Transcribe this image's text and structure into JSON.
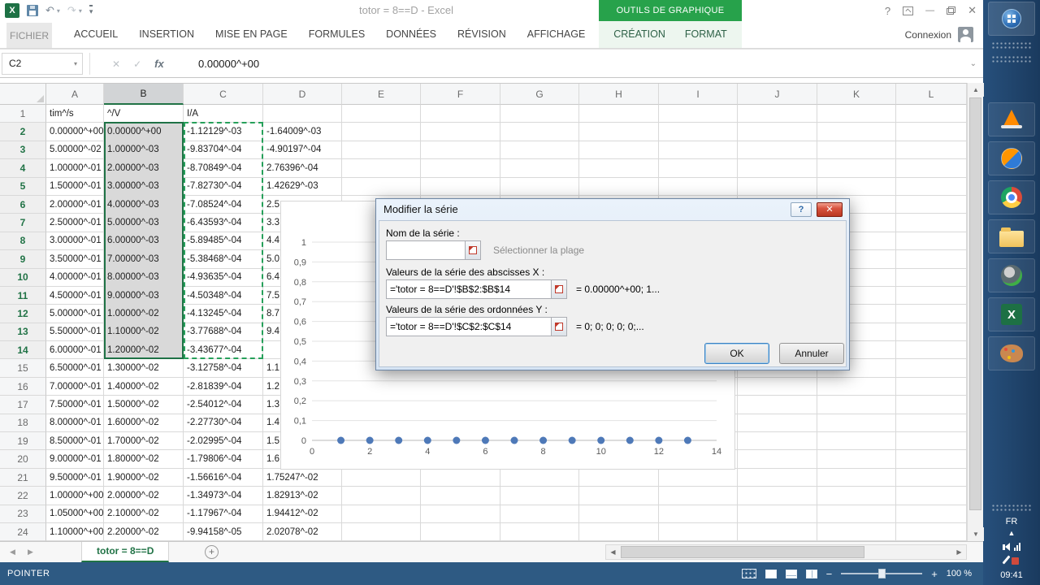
{
  "title_bar": {
    "title": "totor = 8==D - Excel",
    "contextual_header": "OUTILS DE GRAPHIQUE",
    "controls": {
      "help": "?",
      "minimize": "—",
      "close": "✕"
    }
  },
  "qat": {
    "app_glyph": "X",
    "undo": "↶",
    "redo": "↷",
    "dropdown": "▾",
    "more": "▾"
  },
  "ribbon": {
    "file_tab": "FICHIER",
    "tabs": [
      "ACCUEIL",
      "INSERTION",
      "MISE EN PAGE",
      "FORMULES",
      "DONNÉES",
      "RÉVISION",
      "AFFICHAGE"
    ],
    "contextual_tabs": [
      "CRÉATION",
      "FORMAT"
    ],
    "account": "Connexion"
  },
  "formula_bar": {
    "name_box": "C2",
    "namebox_arrow": "▾",
    "cancel_glyph": "✕",
    "enter_glyph": "✓",
    "fx_glyph": "fx",
    "formula": "0.00000^+00",
    "expand": "⌄"
  },
  "grid": {
    "columns": [
      "A",
      "B",
      "C",
      "D",
      "E",
      "F",
      "G",
      "H",
      "I",
      "J",
      "K",
      "L"
    ],
    "selection": {
      "solid_range_col": "B",
      "dashed_range_col": "C",
      "from_row": 2,
      "to_row": 14
    },
    "rows": [
      {
        "n": 1,
        "cells": [
          "tim^/s",
          "^/V",
          "I/A",
          ""
        ]
      },
      {
        "n": 2,
        "cells": [
          "0.00000^+00",
          "0.00000^+00",
          "-1.12129^-03",
          "-1.64009^-03"
        ]
      },
      {
        "n": 3,
        "cells": [
          "5.00000^-02",
          "1.00000^-03",
          "-9.83704^-04",
          "-4.90197^-04"
        ]
      },
      {
        "n": 4,
        "cells": [
          "1.00000^-01",
          "2.00000^-03",
          "-8.70849^-04",
          "2.76396^-04"
        ]
      },
      {
        "n": 5,
        "cells": [
          "1.50000^-01",
          "3.00000^-03",
          "-7.82730^-04",
          "1.42629^-03"
        ]
      },
      {
        "n": 6,
        "cells": [
          "2.00000^-01",
          "4.00000^-03",
          "-7.08524^-04",
          "2.5"
        ]
      },
      {
        "n": 7,
        "cells": [
          "2.50000^-01",
          "5.00000^-03",
          "-6.43593^-04",
          "3.3"
        ]
      },
      {
        "n": 8,
        "cells": [
          "3.00000^-01",
          "6.00000^-03",
          "-5.89485^-04",
          "4.4"
        ]
      },
      {
        "n": 9,
        "cells": [
          "3.50000^-01",
          "7.00000^-03",
          "-5.38468^-04",
          "5.0"
        ]
      },
      {
        "n": 10,
        "cells": [
          "4.00000^-01",
          "8.00000^-03",
          "-4.93635^-04",
          "6.4"
        ]
      },
      {
        "n": 11,
        "cells": [
          "4.50000^-01",
          "9.00000^-03",
          "-4.50348^-04",
          "7.5"
        ]
      },
      {
        "n": 12,
        "cells": [
          "5.00000^-01",
          "1.00000^-02",
          "-4.13245^-04",
          "8.7"
        ]
      },
      {
        "n": 13,
        "cells": [
          "5.50000^-01",
          "1.10000^-02",
          "-3.77688^-04",
          "9.4"
        ]
      },
      {
        "n": 14,
        "cells": [
          "6.00000^-01",
          "1.20000^-02",
          "-3.43677^-04",
          ""
        ]
      },
      {
        "n": 15,
        "cells": [
          "6.50000^-01",
          "1.30000^-02",
          "-3.12758^-04",
          "1.1"
        ]
      },
      {
        "n": 16,
        "cells": [
          "7.00000^-01",
          "1.40000^-02",
          "-2.81839^-04",
          "1.2"
        ]
      },
      {
        "n": 17,
        "cells": [
          "7.50000^-01",
          "1.50000^-02",
          "-2.54012^-04",
          "1.3"
        ]
      },
      {
        "n": 18,
        "cells": [
          "8.00000^-01",
          "1.60000^-02",
          "-2.27730^-04",
          "1.4"
        ]
      },
      {
        "n": 19,
        "cells": [
          "8.50000^-01",
          "1.70000^-02",
          "-2.02995^-04",
          "1.5"
        ]
      },
      {
        "n": 20,
        "cells": [
          "9.00000^-01",
          "1.80000^-02",
          "-1.79806^-04",
          "1.6"
        ]
      },
      {
        "n": 21,
        "cells": [
          "9.50000^-01",
          "1.90000^-02",
          "-1.56616^-04",
          "1.75247^-02"
        ]
      },
      {
        "n": 22,
        "cells": [
          "1.00000^+00",
          "2.00000^-02",
          "-1.34973^-04",
          "1.82913^-02"
        ]
      },
      {
        "n": 23,
        "cells": [
          "1.05000^+00",
          "2.10000^-02",
          "-1.17967^-04",
          "1.94412^-02"
        ]
      },
      {
        "n": 24,
        "cells": [
          "1.10000^+00",
          "2.20000^-02",
          "-9.94158^-05",
          "2.02078^-02"
        ]
      }
    ]
  },
  "chart_data": {
    "type": "scatter",
    "title": "",
    "x": [
      1,
      2,
      3,
      4,
      5,
      6,
      7,
      8,
      9,
      10,
      11,
      12,
      13
    ],
    "y": [
      0,
      0,
      0,
      0,
      0,
      0,
      0,
      0,
      0,
      0,
      0,
      0,
      0
    ],
    "xlim": [
      0,
      14
    ],
    "ylim": [
      0,
      1
    ],
    "x_ticks": [
      0,
      2,
      4,
      6,
      8,
      10,
      12,
      14
    ],
    "x_tick_labels": [
      "0",
      "2",
      "4",
      "6",
      "8",
      "10",
      "12",
      "14"
    ],
    "y_ticks": [
      0,
      0.1,
      0.2,
      0.3,
      0.4,
      0.5,
      0.6,
      0.7,
      0.8,
      0.9,
      1
    ],
    "y_tick_labels": [
      "0",
      "0,1",
      "0,2",
      "0,3",
      "0,4",
      "0,5",
      "0,6",
      "0,7",
      "0,8",
      "0,9",
      "1"
    ],
    "grid": "horizontal",
    "legend": "none",
    "marker_color": "#4E79B8"
  },
  "dialog": {
    "title": "Modifier la série",
    "help_glyph": "?",
    "close_glyph": "✕",
    "name_label": "Nom de la série :",
    "name_value": "",
    "name_hint": "Sélectionner la plage",
    "x_label": "Valeurs de la série des abscisses X :",
    "x_value": "='totor = 8==D'!$B$2:$B$14",
    "x_preview": "= 0.00000^+00; 1...",
    "y_label": "Valeurs de la série des ordonnées Y :",
    "y_value": "='totor = 8==D'!$C$2:$C$14",
    "y_preview": "= 0; 0; 0; 0; 0;...",
    "ok_label": "OK",
    "cancel_label": "Annuler"
  },
  "sheet_tabs": {
    "active": "totor = 8==D",
    "nav_left": "◀",
    "nav_right": "▶",
    "add_sheet": "+"
  },
  "scrollbars": {
    "up": "▲",
    "down": "▼",
    "left": "◀",
    "right": "▶"
  },
  "status_bar": {
    "mode": "POINTER",
    "zoom_out": "−",
    "zoom_in": "+",
    "zoom_label": "100 %"
  },
  "taskbar": {
    "language": "FR",
    "time": "09:41",
    "excel_glyph": "X",
    "collapse": "▲"
  }
}
